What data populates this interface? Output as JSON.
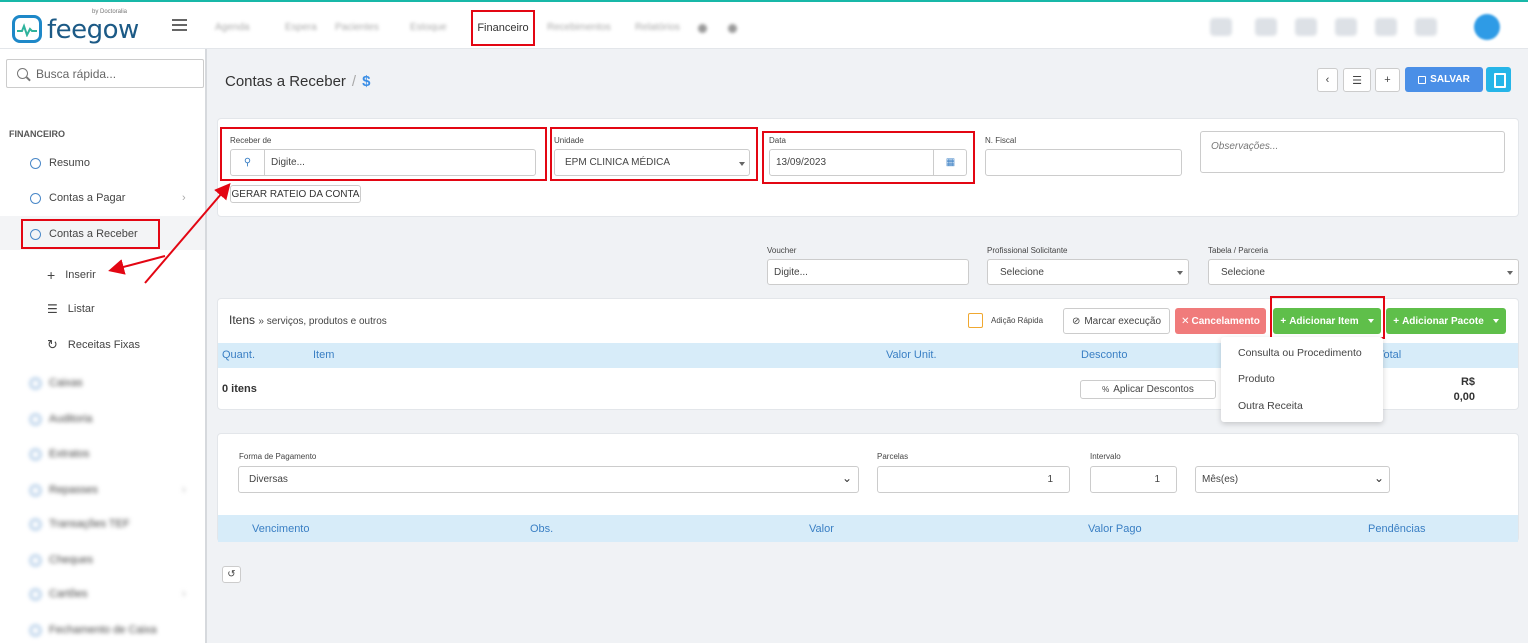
{
  "app": {
    "brand": "feegow",
    "brand_tag": "by Doctoralia"
  },
  "topnav": {
    "items": [
      "Agenda",
      "Espera",
      "Pacientes",
      "Estoque",
      "Recebimentos",
      "Relatórios"
    ],
    "active": "Financeiro"
  },
  "sidebar": {
    "search_placeholder": "Busca rápida...",
    "section": "FINANCEIRO",
    "items": [
      {
        "label": "Resumo",
        "icon": "pie-chart-icon"
      },
      {
        "label": "Contas a Pagar",
        "icon": "arrow-up-circle-icon"
      },
      {
        "label": "Contas a Receber",
        "icon": "arrow-down-circle-icon"
      }
    ],
    "subitems": [
      {
        "label": "Inserir",
        "icon": "plus-icon"
      },
      {
        "label": "Listar",
        "icon": "list-icon"
      },
      {
        "label": "Receitas Fixas",
        "icon": "refresh-icon"
      }
    ],
    "blurred_items": [
      "Caixas",
      "Auditoria",
      "Extratos",
      "Repasses",
      "Transações TEF",
      "Cheques",
      "Cartões",
      "Fechamento de Caixa"
    ]
  },
  "page": {
    "title": "Contas a Receber",
    "title_icon": "$",
    "save_label": "SALVAR"
  },
  "form": {
    "receber_de": {
      "label": "Receber de",
      "placeholder": "Digite..."
    },
    "rateio_label": "GERAR RATEIO DA CONTA",
    "unidade": {
      "label": "Unidade",
      "value": "EPM CLINICA MÉDICA"
    },
    "data": {
      "label": "Data",
      "value": "13/09/2023"
    },
    "nfiscal": {
      "label": "N. Fiscal",
      "value": ""
    },
    "observacoes": {
      "placeholder": "Observações..."
    },
    "voucher": {
      "label": "Voucher",
      "placeholder": "Digite..."
    },
    "profissional": {
      "label": "Profissional Solicitante",
      "value": "Selecione"
    },
    "tabela": {
      "label": "Tabela / Parceria",
      "value": "Selecione"
    }
  },
  "items_section": {
    "title": "Itens",
    "subtitle": "» serviços, produtos e outros",
    "adicao_rapida": "Adição Rápida",
    "marcar_execucao": "Marcar execução",
    "cancelamento": "Cancelamento",
    "adicionar_item": "Adicionar Item",
    "adicionar_pacote": "Adicionar Pacote",
    "columns": [
      "Quant.",
      "Item",
      "Valor Unit.",
      "Desconto",
      "Total"
    ],
    "count": "0 itens",
    "aplicar_descontos": "Aplicar Descontos",
    "total_currency": "R$",
    "total_value": "0,00",
    "dropdown": [
      "Consulta ou Procedimento",
      "Produto",
      "Outra Receita"
    ]
  },
  "payment": {
    "forma": {
      "label": "Forma de Pagamento",
      "value": "Diversas"
    },
    "parcelas": {
      "label": "Parcelas",
      "value": "1"
    },
    "intervalo": {
      "label": "Intervalo",
      "value": "1",
      "unit": "Mês(es)"
    },
    "columns": [
      "Vencimento",
      "Obs.",
      "Valor",
      "Valor Pago",
      "Pendências"
    ]
  },
  "colors": {
    "accent": "#3a8ee6",
    "save": "#4a8fe7",
    "cancel": "#f07b7b",
    "add": "#5fbf4a",
    "highlight": "#e30613"
  }
}
